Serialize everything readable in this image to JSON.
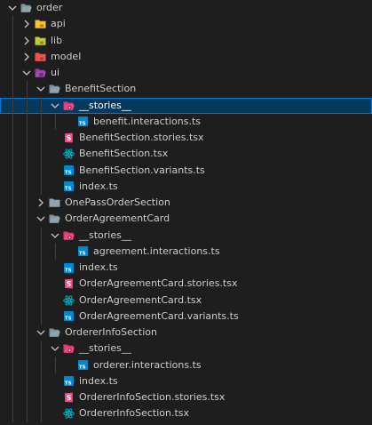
{
  "explorer": {
    "items": [
      {
        "label": "order",
        "depth": 0,
        "kind": "folder",
        "expanded": true,
        "icon": "folder-open-icon"
      },
      {
        "label": "api",
        "depth": 1,
        "kind": "folder",
        "expanded": false,
        "icon": "folder-api-icon"
      },
      {
        "label": "lib",
        "depth": 1,
        "kind": "folder",
        "expanded": false,
        "icon": "folder-lib-icon"
      },
      {
        "label": "model",
        "depth": 1,
        "kind": "folder",
        "expanded": false,
        "icon": "folder-model-icon"
      },
      {
        "label": "ui",
        "depth": 1,
        "kind": "folder",
        "expanded": true,
        "icon": "folder-ui-icon"
      },
      {
        "label": "BenefitSection",
        "depth": 2,
        "kind": "folder",
        "expanded": true,
        "icon": "folder-open-icon"
      },
      {
        "label": "__stories__",
        "depth": 3,
        "kind": "folder",
        "expanded": true,
        "icon": "folder-stories-icon",
        "selected": true
      },
      {
        "label": "benefit.interactions.ts",
        "depth": 4,
        "kind": "file",
        "icon": "typescript-icon"
      },
      {
        "label": "BenefitSection.stories.tsx",
        "depth": 3,
        "kind": "file",
        "icon": "storybook-icon"
      },
      {
        "label": "BenefitSection.tsx",
        "depth": 3,
        "kind": "file",
        "icon": "react-icon"
      },
      {
        "label": "BenefitSection.variants.ts",
        "depth": 3,
        "kind": "file",
        "icon": "typescript-icon"
      },
      {
        "label": "index.ts",
        "depth": 3,
        "kind": "file",
        "icon": "typescript-icon"
      },
      {
        "label": "OnePassOrderSection",
        "depth": 2,
        "kind": "folder",
        "expanded": false,
        "icon": "folder-closed-icon"
      },
      {
        "label": "OrderAgreementCard",
        "depth": 2,
        "kind": "folder",
        "expanded": true,
        "icon": "folder-open-icon"
      },
      {
        "label": "__stories__",
        "depth": 3,
        "kind": "folder",
        "expanded": true,
        "icon": "folder-stories-icon"
      },
      {
        "label": "agreement.interactions.ts",
        "depth": 4,
        "kind": "file",
        "icon": "typescript-icon"
      },
      {
        "label": "index.ts",
        "depth": 3,
        "kind": "file",
        "icon": "typescript-icon"
      },
      {
        "label": "OrderAgreementCard.stories.tsx",
        "depth": 3,
        "kind": "file",
        "icon": "storybook-icon"
      },
      {
        "label": "OrderAgreementCard.tsx",
        "depth": 3,
        "kind": "file",
        "icon": "react-icon"
      },
      {
        "label": "OrderAgreementCard.variants.ts",
        "depth": 3,
        "kind": "file",
        "icon": "typescript-icon"
      },
      {
        "label": "OrdererInfoSection",
        "depth": 2,
        "kind": "folder",
        "expanded": true,
        "icon": "folder-open-icon"
      },
      {
        "label": "__stories__",
        "depth": 3,
        "kind": "folder",
        "expanded": true,
        "icon": "folder-stories-icon"
      },
      {
        "label": "orderer.interactions.ts",
        "depth": 4,
        "kind": "file",
        "icon": "typescript-icon"
      },
      {
        "label": "index.ts",
        "depth": 3,
        "kind": "file",
        "icon": "typescript-icon"
      },
      {
        "label": "OrdererInfoSection.stories.tsx",
        "depth": 3,
        "kind": "file",
        "icon": "storybook-icon"
      },
      {
        "label": "OrdererInfoSection.tsx",
        "depth": 3,
        "kind": "file",
        "icon": "react-icon"
      }
    ]
  },
  "colors": {
    "background": "#1e1e1e",
    "selection": "#04395e",
    "selection_border": "#0078d4",
    "text": "#cccccc",
    "folder_default": "#90a4ae",
    "folder_api": "#fbc02d",
    "folder_lib": "#c0ca33",
    "folder_model": "#ef5350",
    "folder_ui": "#ab47bc",
    "folder_stories": "#ff4081",
    "typescript": "#0288d1",
    "storybook": "#ff4785",
    "react": "#00bcd4"
  }
}
